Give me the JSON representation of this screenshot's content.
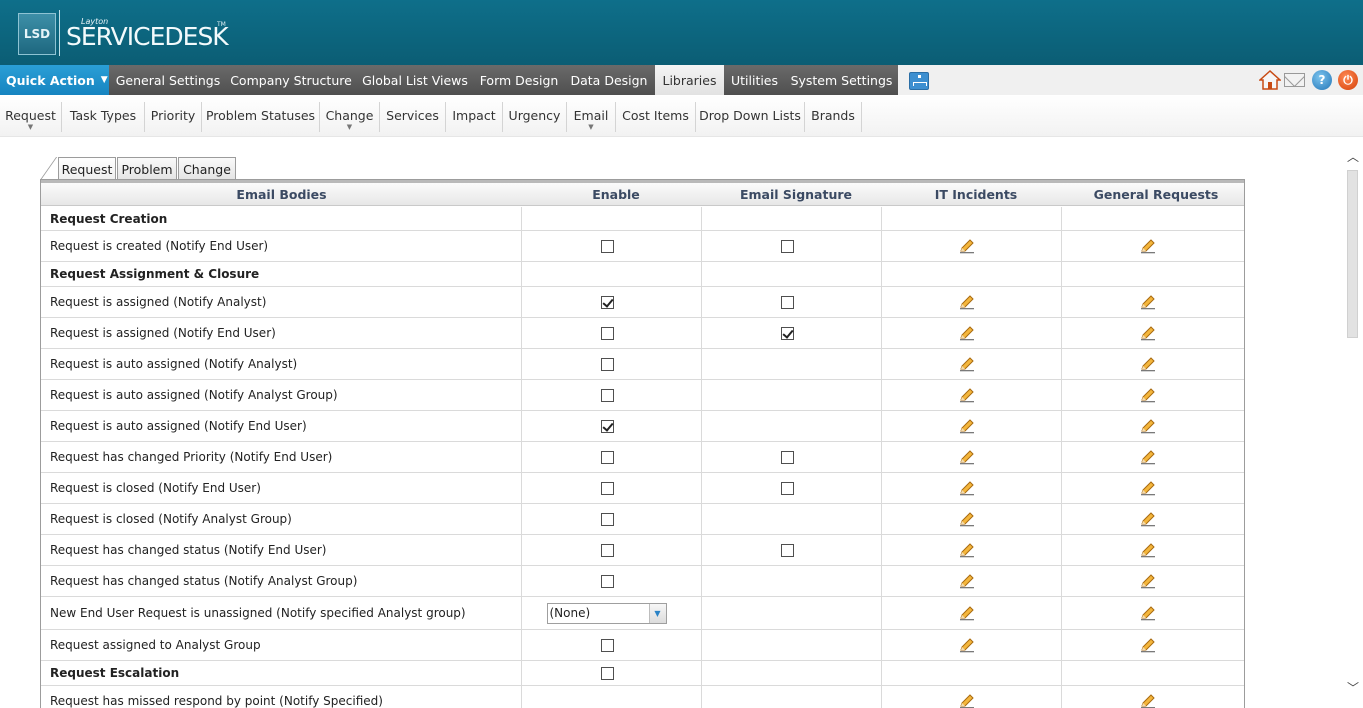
{
  "app": {
    "logo_mark": "LSD",
    "logo_small": "Layton",
    "logo_name": "SERVICEDESK",
    "logo_tm": "TM"
  },
  "mainnav": {
    "quick_action": "Quick Action",
    "items": [
      "General Settings",
      "Company Structure",
      "Global List Views",
      "Form Design",
      "Data Design",
      "Libraries",
      "Utilities",
      "System Settings"
    ],
    "active": "Libraries",
    "icons": [
      "home-icon",
      "mail-icon",
      "help-icon",
      "power-icon"
    ]
  },
  "subnav": {
    "items": [
      "Request",
      "Task Types",
      "Priority",
      "Problem Statuses",
      "Change",
      "Services",
      "Impact",
      "Urgency",
      "Email",
      "Cost Items",
      "Drop Down Lists",
      "Brands"
    ]
  },
  "tabs": [
    "Request",
    "Problem",
    "Change"
  ],
  "grid": {
    "headers": [
      "Email Bodies",
      "Enable",
      "Email Signature",
      "IT Incidents",
      "General Requests"
    ],
    "rows": [
      {
        "label": "Request Creation",
        "section": true
      },
      {
        "label": "Request is created (Notify End User)",
        "enable": "unchecked",
        "signature": "unchecked",
        "it": true,
        "general": true
      },
      {
        "label": "Request Assignment & Closure",
        "section": true
      },
      {
        "label": "Request is assigned (Notify Analyst)",
        "enable": "checked",
        "signature": "unchecked",
        "it": true,
        "general": true
      },
      {
        "label": "Request is assigned (Notify End User)",
        "enable": "unchecked",
        "signature": "checked",
        "it": true,
        "general": true
      },
      {
        "label": "Request is auto assigned (Notify Analyst)",
        "enable": "unchecked",
        "it": true,
        "general": true
      },
      {
        "label": "Request is auto assigned (Notify Analyst Group)",
        "enable": "unchecked",
        "it": true,
        "general": true
      },
      {
        "label": "Request is auto assigned (Notify End User)",
        "enable": "checked",
        "it": true,
        "general": true
      },
      {
        "label": "Request has changed Priority (Notify End User)",
        "enable": "unchecked",
        "signature": "unchecked",
        "it": true,
        "general": true
      },
      {
        "label": "Request is closed (Notify End User)",
        "enable": "unchecked",
        "signature": "unchecked",
        "it": true,
        "general": true
      },
      {
        "label": "Request is closed (Notify Analyst Group)",
        "enable": "unchecked",
        "it": true,
        "general": true
      },
      {
        "label": "Request has changed status (Notify End User)",
        "enable": "unchecked",
        "signature": "unchecked",
        "it": true,
        "general": true
      },
      {
        "label": "Request has changed status (Notify Analyst Group)",
        "enable": "unchecked",
        "it": true,
        "general": true
      },
      {
        "label": "New End User Request is unassigned (Notify specified Analyst group)",
        "enable_select": "(None)",
        "it": true,
        "general": true
      },
      {
        "label": "Request assigned to Analyst Group",
        "enable": "unchecked",
        "it": true,
        "general": true
      },
      {
        "label": "Request Escalation",
        "section": true,
        "enable": "unchecked"
      },
      {
        "label": "Request has missed respond by point (Notify Specified)",
        "it": true,
        "general": true
      }
    ]
  },
  "colors": {
    "header_bg": "#0e6f8a",
    "quick_action_bg": "#1f95cf",
    "nav_bg": "#5c5c5c",
    "header_text": "#3b4a63"
  }
}
